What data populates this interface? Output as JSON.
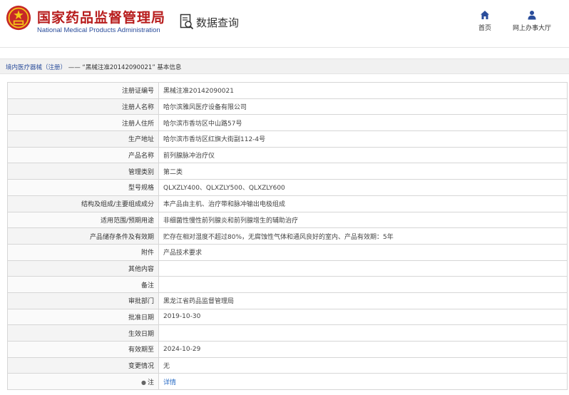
{
  "header": {
    "site_title_cn": "国家药品监督管理局",
    "site_title_en": "National Medical Products Administration",
    "query_label": "数据查询",
    "nav_home": "首页",
    "nav_office": "网上办事大厅"
  },
  "breadcrumb": {
    "link": "境内医疗器械（注册）",
    "separator": "——",
    "current": "“黑械注准20142090021”  基本信息"
  },
  "details": [
    {
      "label": "注册证编号",
      "value": "黑械注准20142090021"
    },
    {
      "label": "注册人名称",
      "value": "哈尔滨雅风医疗设备有限公司"
    },
    {
      "label": "注册人住所",
      "value": "哈尔滨市香坊区中山路57号"
    },
    {
      "label": "生产地址",
      "value": "哈尔滨市香坊区红旗大街副112-4号"
    },
    {
      "label": "产品名称",
      "value": "前列腺脉冲治疗仪"
    },
    {
      "label": "管理类别",
      "value": "第二类"
    },
    {
      "label": "型号规格",
      "value": "QLXZLY400、QLXZLY500、QLXZLY600"
    },
    {
      "label": "结构及组成/主要组成成分",
      "value": "本产品由主机、治疗带和脉冲输出电极组成"
    },
    {
      "label": "适用范围/预期用途",
      "value": "非细菌性慢性前列腺炎和前列腺增生的辅助治疗"
    },
    {
      "label": "产品储存条件及有效期",
      "value": "贮存在相对湿度不超过80%，无腐蚀性气体和通风良好的室内、产品有效期：5年"
    },
    {
      "label": "附件",
      "value": "产品技术要求"
    },
    {
      "label": "其他内容",
      "value": ""
    },
    {
      "label": "备注",
      "value": ""
    },
    {
      "label": "审批部门",
      "value": "黑龙江省药品监督管理局"
    },
    {
      "label": "批准日期",
      "value": "2019-10-30"
    },
    {
      "label": "生效日期",
      "value": ""
    },
    {
      "label": "有效期至",
      "value": "2024-10-29"
    },
    {
      "label": "变更情况",
      "value": "无"
    }
  ],
  "note_row": {
    "label": "注",
    "link": "详情"
  }
}
